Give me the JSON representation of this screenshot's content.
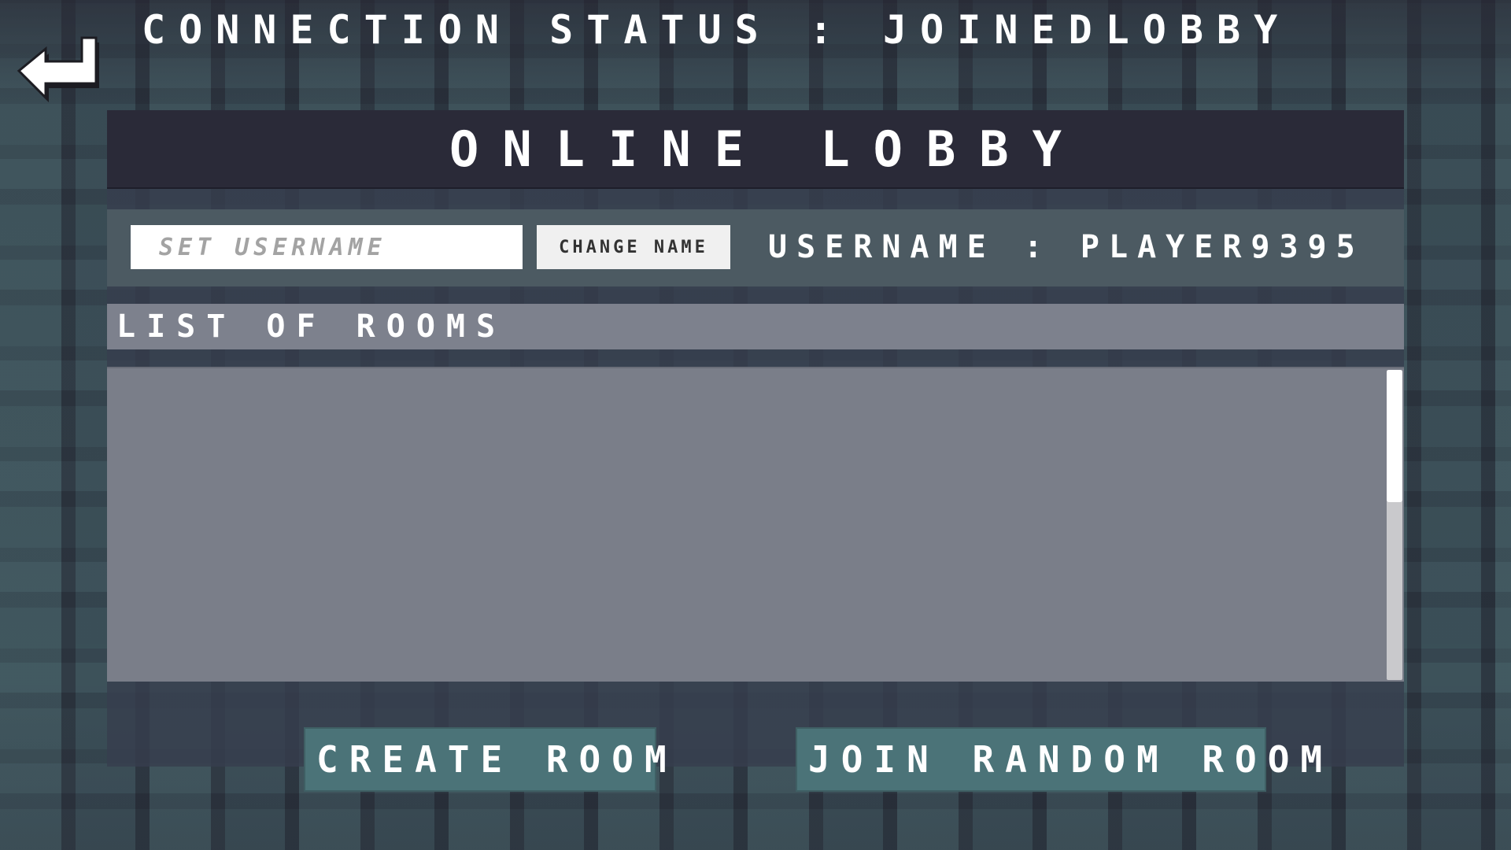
{
  "header": {
    "connection_status": "CONNECTION STATUS : JOINEDLOBBY",
    "back_icon": "back-arrow-icon"
  },
  "lobby": {
    "title": "ONLINE LOBBY",
    "username_input": {
      "placeholder": "SET USERNAME",
      "value": ""
    },
    "change_name_label": "CHANGE NAME",
    "username_label": "USERNAME : PLAYER9395",
    "rooms_header": "LIST OF ROOMS",
    "rooms": []
  },
  "actions": {
    "create_room_label": "CREATE ROOM",
    "join_random_label": "JOIN RANDOM ROOM"
  },
  "colors": {
    "title_bar": "#2a2a38",
    "name_row": "#4c5a62",
    "rooms_header": "#7d818d",
    "rooms_list": "#7a7e89",
    "button": "#4b7378"
  }
}
